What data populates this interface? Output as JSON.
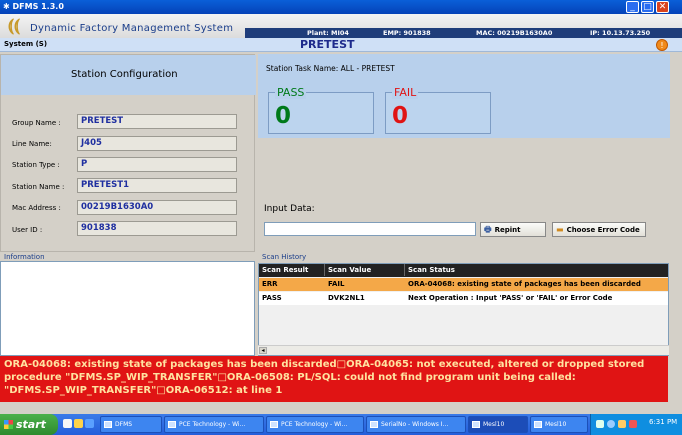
{
  "window": {
    "title": "DFMS 1.3.0"
  },
  "banner": {
    "app_name": "Dynamic Factory Management System",
    "plant": "Plant: MI04",
    "emp": "EMP: 901838",
    "mac": "MAC: 00219B1630A0",
    "ip": "IP: 10.13.73.250"
  },
  "menubar": {
    "system": "System (S)",
    "screen_title": "PRETEST",
    "help_icon": "!"
  },
  "station_config": {
    "title": "Station Configuration",
    "group_name_label": "Group Name :",
    "group_name": "PRETEST",
    "line_name_label": "Line Name:",
    "line_name": "J405",
    "station_type_label": "Station Type :",
    "station_type": "P",
    "station_name_label": "Station Name :",
    "station_name": "PRETEST1",
    "mac_label": "Mac Address :",
    "mac": "00219B1630A0",
    "user_id_label": "User ID :",
    "user_id": "901838"
  },
  "task": {
    "name": "Station Task Name: ALL - PRETEST",
    "pass_label": "PASS",
    "pass_count": "0",
    "fail_label": "FAIL",
    "fail_count": "0",
    "pass_color": "#007a1a",
    "fail_color": "#e01414"
  },
  "input": {
    "label": "Input Data:",
    "value": "",
    "reprint": "Repint",
    "choose_error": "Choose Error Code"
  },
  "information": {
    "label": "Information"
  },
  "scan_history": {
    "label": "Scan History",
    "columns": [
      "Scan Result",
      "Scan Value",
      "Scan Status"
    ],
    "rows": [
      [
        "ERR",
        "FAIL",
        "ORA-04068: existing state of packages has been discarded"
      ],
      [
        "PASS",
        "DVK2NL1",
        "Next Operation : Input 'PASS' or 'FAIL' or Error Code"
      ]
    ]
  },
  "error_message": "ORA-04068: existing state of packages has been discarded□ORA-04065: not executed, altered or dropped stored procedure \"DFMS.SP_WIP_TRANSFER\"□ORA-06508: PL/SQL: could not find program unit being called: \"DFMS.SP_WIP_TRANSFER\"□ORA-06512: at line 1",
  "taskbar": {
    "start": "start",
    "tasks": [
      "DFMS",
      "PCE Technology - Wi...",
      "PCE Technology - Wi...",
      "SerialNo - Windows I...",
      "Mesl10",
      "Mesl10"
    ],
    "clock": "6:31 PM"
  }
}
